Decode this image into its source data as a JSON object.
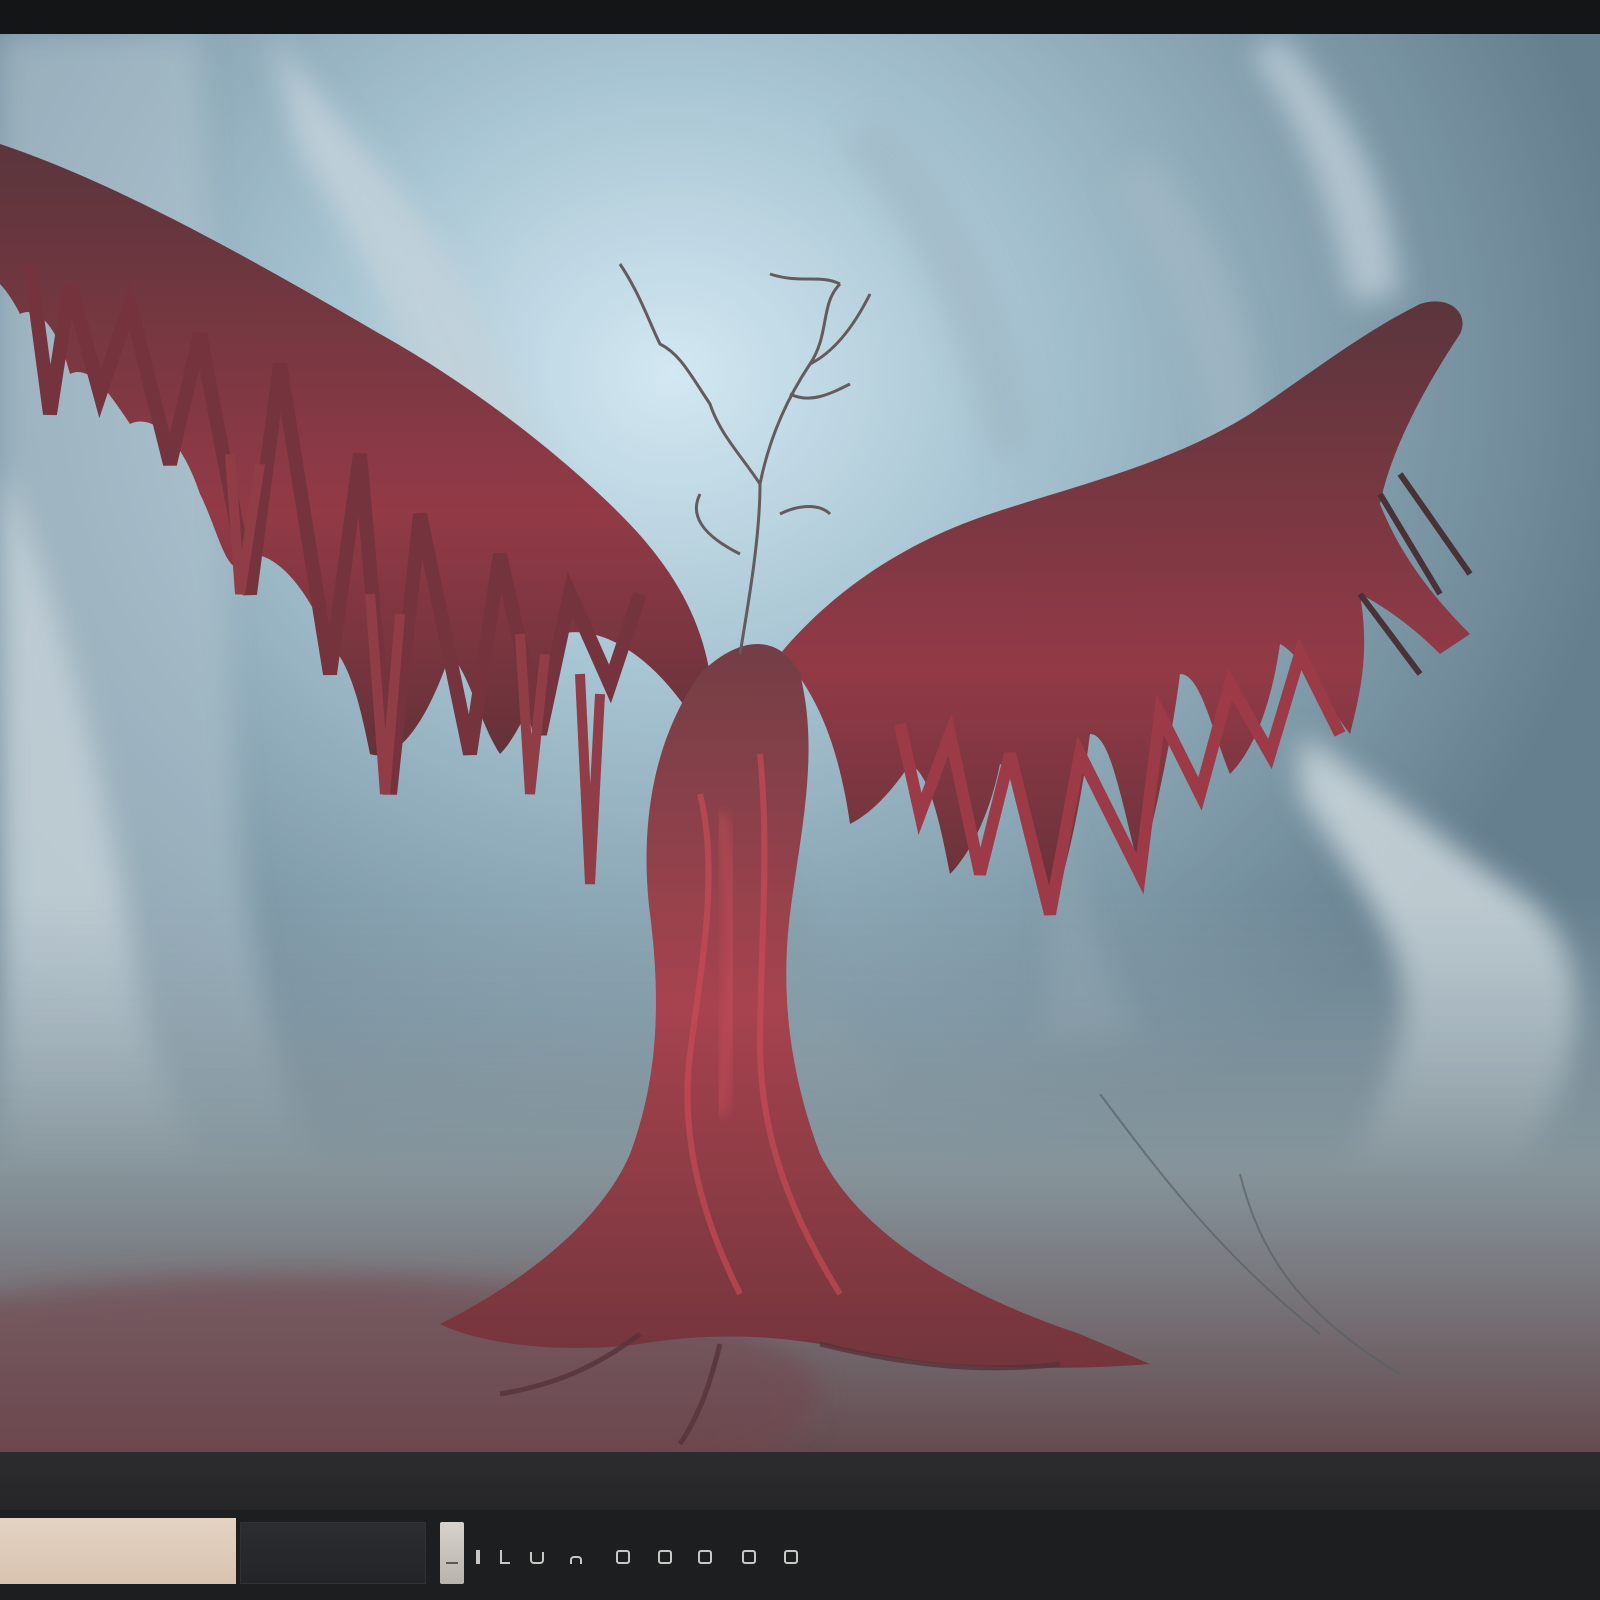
{
  "viewer": {
    "image_subject": "",
    "colors": {
      "fog": "#a9c3cf",
      "fog_deep": "#6d8795",
      "tree_red": "#8e2430",
      "tree_dark": "#4a1c22",
      "ground": "#7c8a90",
      "ui_background": "#1d1e20",
      "ui_topbar": "#141516"
    }
  },
  "filmstrip": {
    "thumbnails": [
      {
        "state": "active",
        "color": "#dccab8"
      },
      {
        "state": "inactive",
        "color": "#26282b"
      }
    ]
  },
  "controls": [
    {
      "icon": "bar-icon"
    },
    {
      "icon": "l-shape-icon"
    },
    {
      "icon": "cup-icon"
    },
    {
      "icon": "half-ring-icon"
    },
    {
      "icon": "pill-icon"
    },
    {
      "icon": "pill-icon"
    },
    {
      "icon": "pill-icon"
    },
    {
      "icon": "pill-icon"
    },
    {
      "icon": "pill-icon"
    }
  ]
}
